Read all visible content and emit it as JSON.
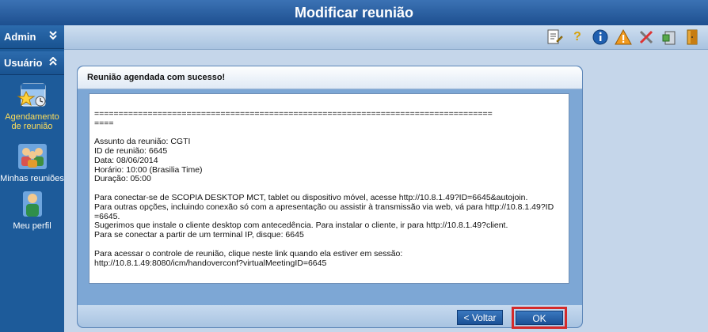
{
  "window": {
    "title": "Modificar reunião"
  },
  "sidebar": {
    "sections": [
      {
        "label": "Admin",
        "chevron": "»"
      },
      {
        "label": "Usuário",
        "chevron": "«"
      }
    ],
    "items": [
      {
        "label": "Agendamento de reunião",
        "icon": "calendar-star-icon",
        "active": true
      },
      {
        "label": "Minhas reuniões",
        "icon": "people-group-icon",
        "active": false
      },
      {
        "label": "Meu perfil",
        "icon": "user-profile-icon",
        "active": false
      }
    ]
  },
  "toolbar": {
    "icons": [
      {
        "name": "edit-document-icon",
        "glyph": "✎"
      },
      {
        "name": "help-question-icon",
        "glyph": "?"
      },
      {
        "name": "info-icon",
        "glyph": "i"
      },
      {
        "name": "warning-icon",
        "glyph": "!"
      },
      {
        "name": "tools-icon",
        "glyph": "✕"
      },
      {
        "name": "server-icon",
        "glyph": "▣"
      },
      {
        "name": "logout-door-icon",
        "glyph": "▮"
      }
    ]
  },
  "panel": {
    "title": "Reunião agendada com sucesso!",
    "message_lines": [
      "",
      "==================================================================================",
      "====",
      "",
      "Assunto da reunião: CGTI",
      "ID de reunião: 6645",
      "Data: 08/06/2014",
      "Horário: 10:00 (Brasilia Time)",
      "Duração: 05:00",
      "",
      "Para conectar-se de SCOPIA DESKTOP MCT, tablet ou dispositivo móvel, acesse http://10.8.1.49?ID=6645&autojoin.",
      "Para outras opções, incluindo conexão só com a apresentação ou assistir à transmissão via web, vá para http://10.8.1.49?ID",
      "=6645.",
      "Sugerimos que instale o cliente desktop com antecedência. Para instalar o cliente, ir para http://10.8.1.49?client.",
      "Para se conectar a partir de um terminal IP, disque: 6645",
      "",
      "Para acessar o controle de reunião, clique neste link quando ela estiver em sessão:",
      "http://10.8.1.49:8080/icm/handoverconf?virtualMeetingID=6645"
    ],
    "back_label": "< Voltar",
    "ok_label": "OK"
  },
  "colors": {
    "highlight_border": "#d42a2a",
    "active_label": "#ffde5a",
    "primary": "#1d5b9a"
  }
}
